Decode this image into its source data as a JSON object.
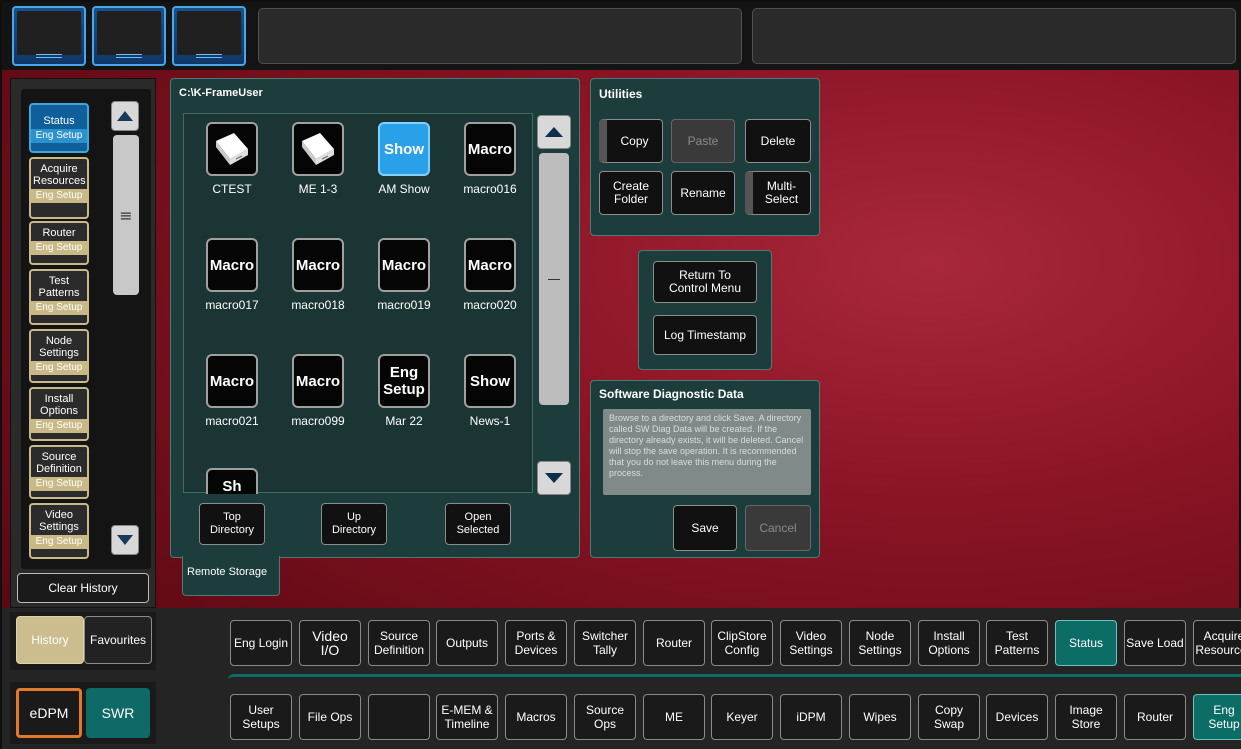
{
  "file_browser": {
    "path": "C:\\K-FrameUser",
    "items": [
      {
        "icon": "disk",
        "label": "CTEST"
      },
      {
        "icon": "disk",
        "label": "ME 1-3"
      },
      {
        "icon": "text",
        "icon_text": "Show",
        "label": "AM Show",
        "selected": true
      },
      {
        "icon": "text",
        "icon_text": "Macro",
        "label": "macro016"
      },
      {
        "icon": "text",
        "icon_text": "Macro",
        "label": "macro017"
      },
      {
        "icon": "text",
        "icon_text": "Macro",
        "label": "macro018"
      },
      {
        "icon": "text",
        "icon_text": "Macro",
        "label": "macro019"
      },
      {
        "icon": "text",
        "icon_text": "Macro",
        "label": "macro020"
      },
      {
        "icon": "text",
        "icon_text": "Macro",
        "label": "macro021"
      },
      {
        "icon": "text",
        "icon_text": "Macro",
        "label": "macro099"
      },
      {
        "icon": "text",
        "icon_text": "Eng\nSetup",
        "label": "Mar 22"
      },
      {
        "icon": "text",
        "icon_text": "Show",
        "label": "News-1"
      }
    ],
    "partial_item_text": "Sh",
    "buttons": {
      "top": "Top\nDirectory",
      "up": "Up\nDirectory",
      "open": "Open\nSelected"
    },
    "remote_tab": "Remote Storage"
  },
  "utilities": {
    "title": "Utilities",
    "copy": "Copy",
    "paste": "Paste",
    "delete": "Delete",
    "create_folder": "Create\nFolder",
    "rename": "Rename",
    "multi_select": "Multi-\nSelect"
  },
  "control": {
    "return": "Return To\nControl Menu",
    "log": "Log Timestamp"
  },
  "diagnostic": {
    "title": "Software Diagnostic Data",
    "description": "Browse to a directory and click Save. A directory called SW Diag Data will be created. If the directory already exists, it will be deleted. Cancel will stop the save operation. It is recommended that you do not leave this menu during the process.",
    "save": "Save",
    "cancel": "Cancel"
  },
  "sidebar": {
    "items": [
      {
        "label": "Status",
        "sub": "Eng Setup",
        "active": true
      },
      {
        "label": "Acquire\nResources",
        "sub": "Eng Setup"
      },
      {
        "label": "Router",
        "sub": "Eng Setup"
      },
      {
        "label": "Test\nPatterns",
        "sub": "Eng Setup"
      },
      {
        "label": "Node\nSettings",
        "sub": "Eng Setup"
      },
      {
        "label": "Install\nOptions",
        "sub": "Eng Setup"
      },
      {
        "label": "Source\nDefinition",
        "sub": "Eng Setup"
      },
      {
        "label": "Video\nSettings",
        "sub": "Eng Setup"
      }
    ],
    "clear_history": "Clear History",
    "history": "History",
    "favourites": "Favourites"
  },
  "mode": {
    "edpm": "eDPM",
    "swr": "SWR"
  },
  "tabs_row1": [
    "Eng Login",
    "Video\nI/O",
    "Source\nDefinition",
    "Outputs",
    "Ports &\nDevices",
    "Switcher\nTally",
    "Router",
    "ClipStore\nConfig",
    "Video\nSettings",
    "Node\nSettings",
    "Install\nOptions",
    "Test\nPatterns",
    "Status",
    "Save Load",
    "Acquire\nResources"
  ],
  "tabs_row2": [
    "User\nSetups",
    "File Ops",
    "",
    "E-MEM &\nTimeline",
    "Macros",
    "Source\nOps",
    "ME",
    "Keyer",
    "iDPM",
    "Wipes",
    "Copy\nSwap",
    "Devices",
    "Image\nStore",
    "Router",
    "Eng\nSetup"
  ],
  "colors": {
    "accent_teal": "#0c6c66",
    "selected_blue": "#2aa0e8",
    "history_tan": "#c9b987",
    "edpm_orange": "#e07a2a"
  }
}
